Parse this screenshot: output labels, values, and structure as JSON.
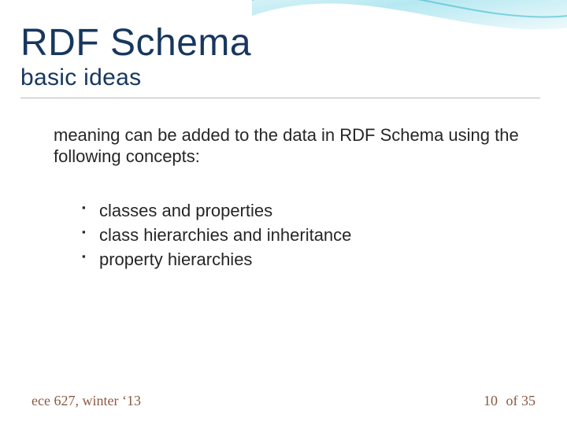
{
  "slide": {
    "title": "RDF Schema",
    "subtitle": "basic ideas",
    "intro": "meaning can be added to the data in RDF Schema using the following concepts:",
    "bullets": [
      "classes and properties",
      "class hierarchies and inheritance",
      "property hierarchies"
    ],
    "footer": {
      "course": "ece 627, winter ‘13",
      "page_number": "10",
      "page_sep": "of",
      "page_total": "35"
    },
    "colors": {
      "heading": "#17375e",
      "accent_wave_light": "#bfe7ee",
      "accent_wave_mid": "#56c8dd",
      "footer_text": "#8a5a44"
    }
  }
}
